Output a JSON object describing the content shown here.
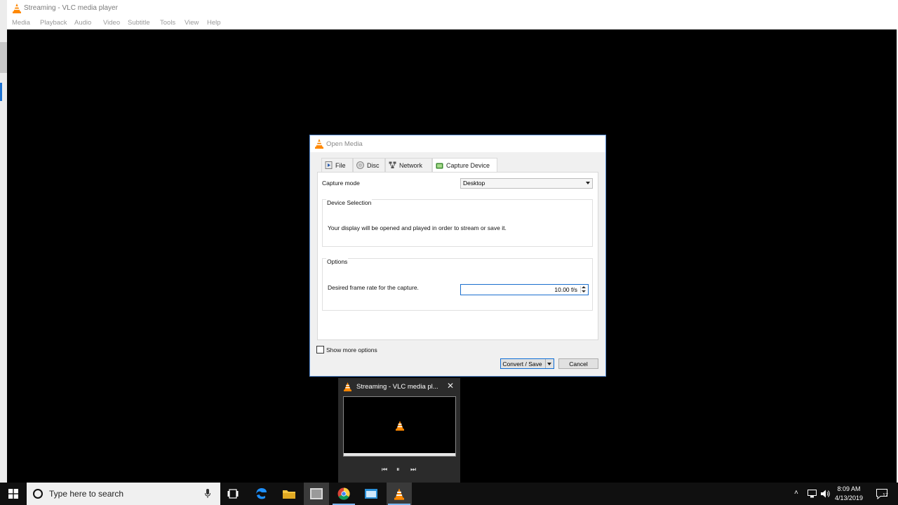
{
  "window": {
    "title": "Streaming - VLC media player",
    "menu": [
      "Media",
      "Playback",
      "Audio",
      "Video",
      "Subtitle",
      "Tools",
      "View",
      "Help"
    ]
  },
  "dialog": {
    "title": "Open Media",
    "tabs": [
      {
        "label": "File",
        "icon": "file-icon"
      },
      {
        "label": "Disc",
        "icon": "disc-icon"
      },
      {
        "label": "Network",
        "icon": "network-icon"
      },
      {
        "label": "Capture Device",
        "icon": "capture-device-icon",
        "active": true
      }
    ],
    "capture_mode_label": "Capture mode",
    "capture_mode_value": "Desktop",
    "device_selection": {
      "title": "Device Selection",
      "text": "Your display will be opened and played in order to stream or save it."
    },
    "options": {
      "title": "Options",
      "frame_rate_label": "Desired frame rate for the capture.",
      "frame_rate_value": "10.00 f/s"
    },
    "show_more_options": {
      "label": "Show more options",
      "checked": false
    },
    "convert_save_label": "Convert / Save",
    "cancel_label": "Cancel"
  },
  "thumbnail": {
    "title": "Streaming - VLC media pl...",
    "controls": [
      "previous-icon",
      "pause-icon",
      "next-icon"
    ]
  },
  "taskbar": {
    "search_placeholder": "Type here to search",
    "apps": [
      "task-view-icon",
      "edge-icon",
      "file-explorer-icon",
      "app-icon",
      "chrome-icon",
      "app-window-icon",
      "vlc-icon"
    ],
    "time": "8:09 AM",
    "date": "4/13/2019",
    "notification_count": "17"
  },
  "colors": {
    "vlc_orange": "#ff8800",
    "accent_blue": "#0f6ed6",
    "taskbar": "#101010"
  }
}
